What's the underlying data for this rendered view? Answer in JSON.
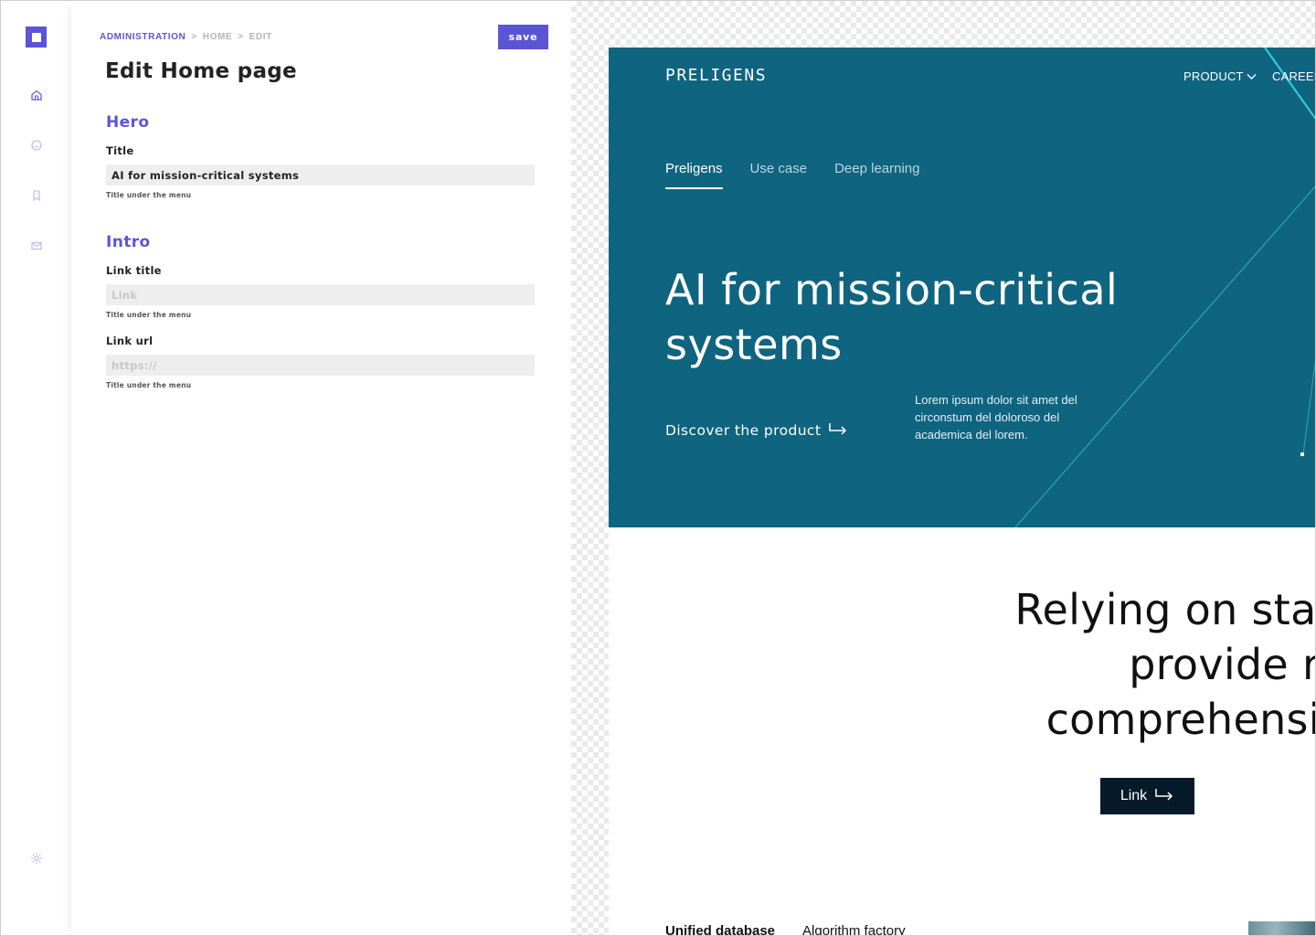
{
  "breadcrumb": {
    "items": [
      "ADMINISTRATION",
      "HOME",
      "EDIT"
    ],
    "separator": ">"
  },
  "toolbar": {
    "save_label": "save"
  },
  "page": {
    "title": "Edit Home page"
  },
  "sections": {
    "hero": {
      "title": "Hero",
      "title_field": {
        "label": "Title",
        "value": "AI for mission-critical systems",
        "hint": "Title under the menu"
      }
    },
    "intro": {
      "title": "Intro",
      "link_title_field": {
        "label": "Link title",
        "placeholder": "Link",
        "hint": "Title under the menu"
      },
      "link_url_field": {
        "label": "Link url",
        "placeholder": "https://",
        "hint": "Title under the menu"
      }
    }
  },
  "rail": {
    "icons": [
      "app-logo-icon",
      "home-icon",
      "smiley-icon",
      "bookmark-icon",
      "mail-icon",
      "gear-icon"
    ]
  },
  "preview": {
    "brand": "PRELIGENS",
    "nav": {
      "product": "PRODUCT",
      "careers": "CAREER"
    },
    "tabs": [
      "Preligens",
      "Use case",
      "Deep learning"
    ],
    "hero_title": "AI for mission-critical systems",
    "hero_cta": "Discover the product",
    "hero_description": "Lorem ipsum dolor sit amet del circonstum del doloroso del academica del lorem.",
    "statement_lines": [
      "Relying on state-of-the",
      "provide reliable a",
      "comprehensive inforr"
    ],
    "link_button": "Link",
    "bottom_tabs": [
      "Unified database",
      "Algorithm factory"
    ]
  },
  "colors": {
    "accent": "#5b55d6",
    "hero_bg": "#0f6480",
    "dark_button": "#061a2a",
    "input_bg": "#eeeeee"
  }
}
